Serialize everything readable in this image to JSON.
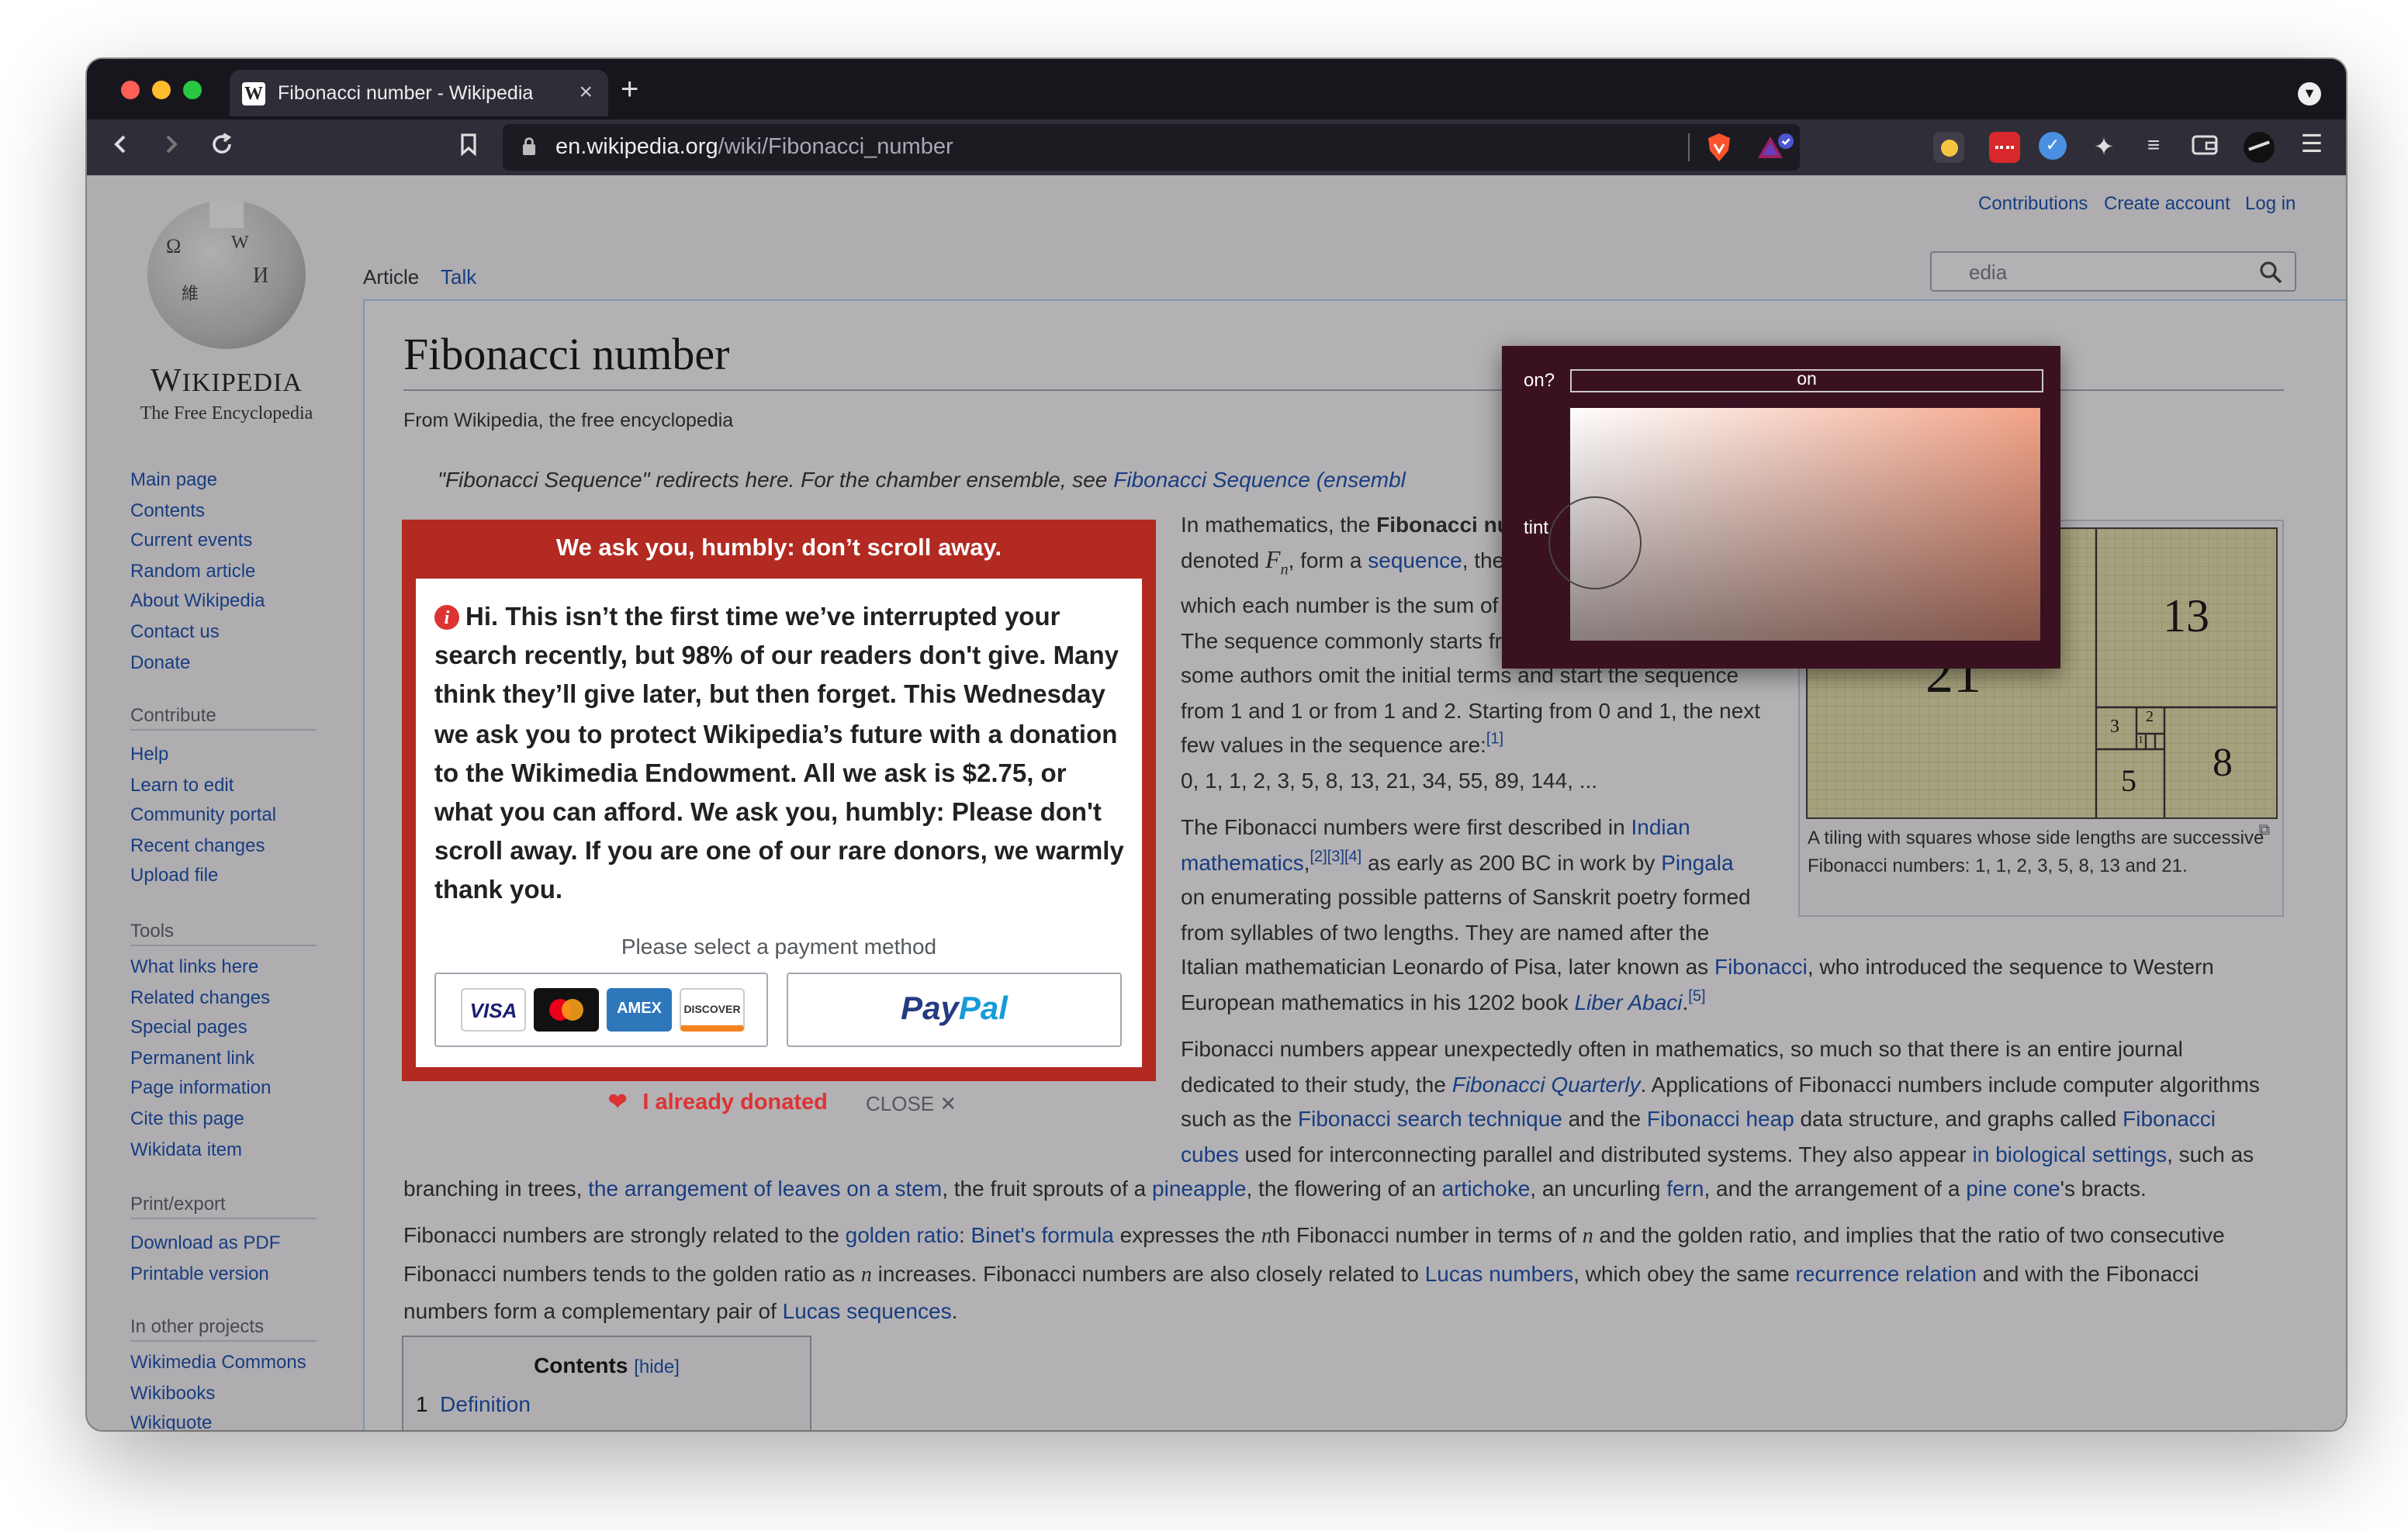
{
  "browser": {
    "tab_title": "Fibonacci number - Wikipedia",
    "url_host": "en.wikipedia.org",
    "url_path": "/wiki/Fibonacci_number"
  },
  "wiki": {
    "wordmark": "Wikipedia",
    "tagline": "The Free Encyclopedia",
    "sidebar": {
      "main": [
        "Main page",
        "Contents",
        "Current events",
        "Random article",
        "About Wikipedia",
        "Contact us",
        "Donate"
      ],
      "contribute_heading": "Contribute",
      "contribute": [
        "Help",
        "Learn to edit",
        "Community portal",
        "Recent changes",
        "Upload file"
      ],
      "tools_heading": "Tools",
      "tools": [
        "What links here",
        "Related changes",
        "Special pages",
        "Permanent link",
        "Page information",
        "Cite this page",
        "Wikidata item"
      ],
      "print_heading": "Print/export",
      "print": [
        "Download as PDF",
        "Printable version"
      ],
      "projects_heading": "In other projects",
      "projects": [
        "Wikimedia Commons",
        "Wikibooks",
        "Wikiquote"
      ]
    },
    "tabs": {
      "article": "Article",
      "talk": "Talk"
    },
    "personal": {
      "contributions": "Contributions",
      "create_account": "Create account",
      "login": "Log in"
    },
    "search_placeholder_visible": "edia",
    "title": "Fibonacci number",
    "from": "From Wikipedia, the free encyclopedia",
    "hatnote_text": "\"Fibonacci Sequence\" redirects here. For the chamber ensemble, see ",
    "hatnote_link": "Fibonacci Sequence (ensembl",
    "figure": {
      "n21": "21",
      "n13": "13",
      "n8": "8",
      "n5": "5",
      "n3": "3",
      "n2": "2",
      "n1": "1",
      "caption": "A tiling with squares whose side lengths are successive Fibonacci numbers: 1, 1, 2, 3, 5, 8, 13 and 21."
    },
    "toc": {
      "title": "Contents",
      "hide": "[hide]",
      "item1_num": "1",
      "item1": "Definition"
    }
  },
  "banner": {
    "heading": "We ask you, humbly: don’t scroll away.",
    "body": "Hi. This isn’t the first time we’ve interrupted your search recently, but 98% of our readers don't give. Many think they’ll give later, but then forget. This Wednesday we ask you to protect Wikipedia’s future with a donation to the Wikimedia Endowment. All we ask is $2.75, or what you can afford. We ask you, humbly: Please don't scroll away. If you are one of our rare donors, we warmly thank you.",
    "payment_label": "Please select a payment method",
    "cards": [
      "VISA",
      "",
      "AMEX",
      "DISCOVER"
    ],
    "paypal": "PayPal",
    "already_donated": "I already donated",
    "close": "CLOSE"
  },
  "popup": {
    "on_label": "on?",
    "on_value": "on",
    "tint_label": "tint"
  },
  "colors": {
    "banner_red": "#b22a21",
    "link": "#0645ad",
    "popup_bg": "#3a1121"
  }
}
